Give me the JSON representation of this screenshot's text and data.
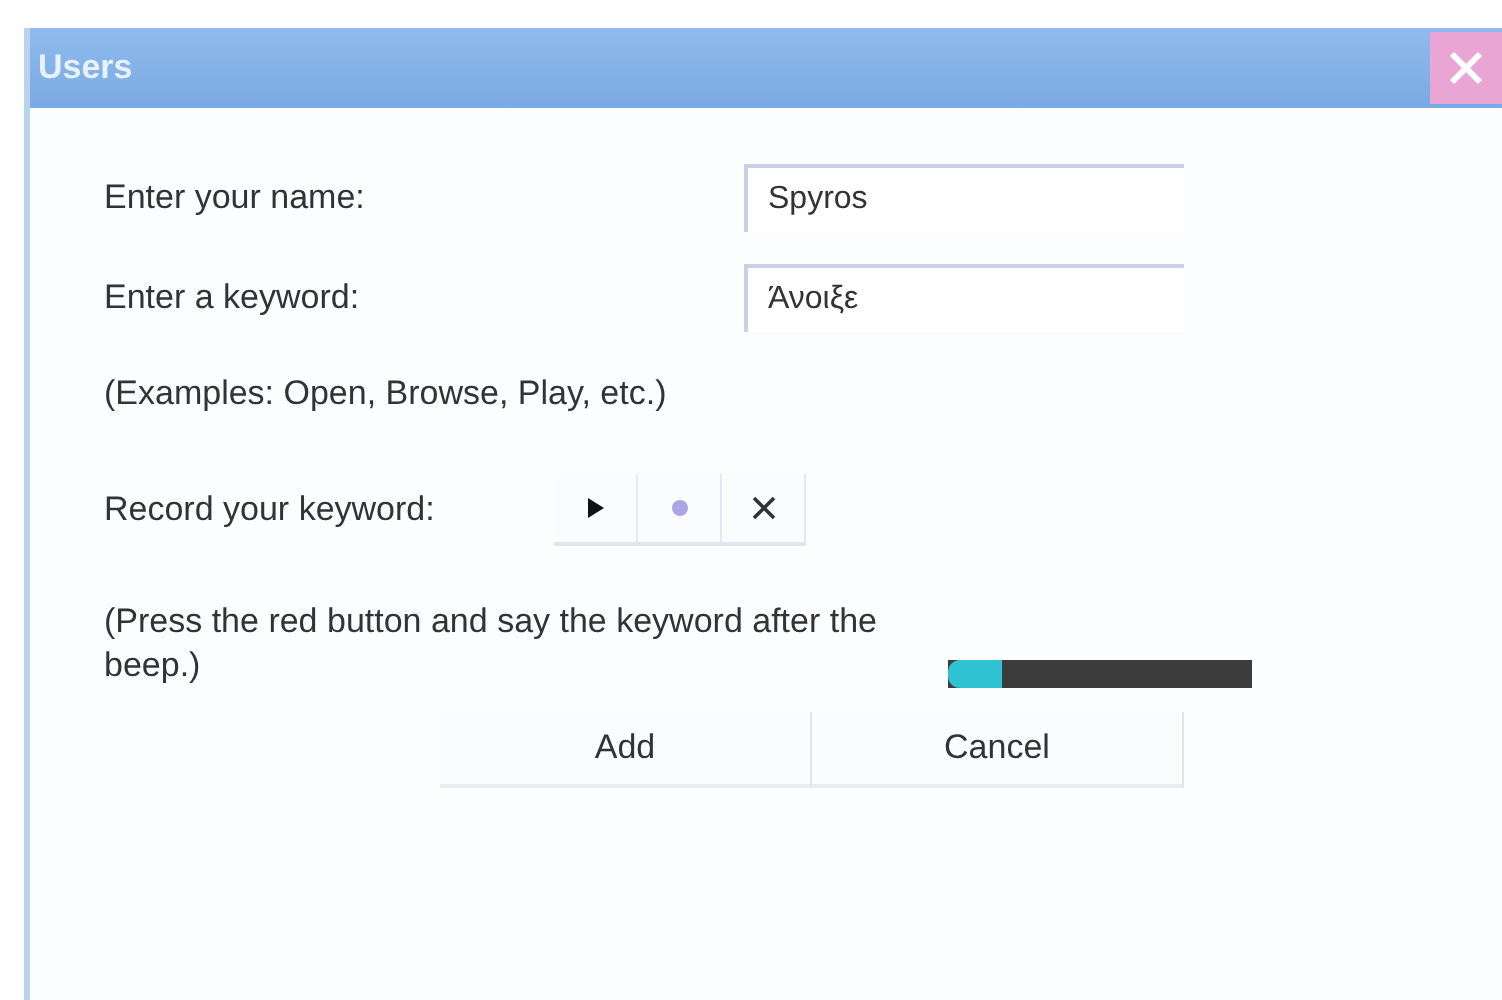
{
  "window": {
    "title": "Users"
  },
  "fields": [
    {
      "label": "Enter your name:",
      "value": "Spyros"
    },
    {
      "label": "Enter a keyword:",
      "value": "Άνοιξε"
    }
  ],
  "examples": "(Examples: Open, Browse, Play, etc.)",
  "record": {
    "label": "Record your keyword:",
    "buttons": [
      {
        "kind": "play"
      },
      {
        "kind": "record"
      },
      {
        "kind": "delete"
      }
    ]
  },
  "instructions": "(Press the red button and say the keyword after the beep.)",
  "progress": {
    "level": 0.18
  },
  "buttons": [
    "Add",
    "Cancel"
  ]
}
